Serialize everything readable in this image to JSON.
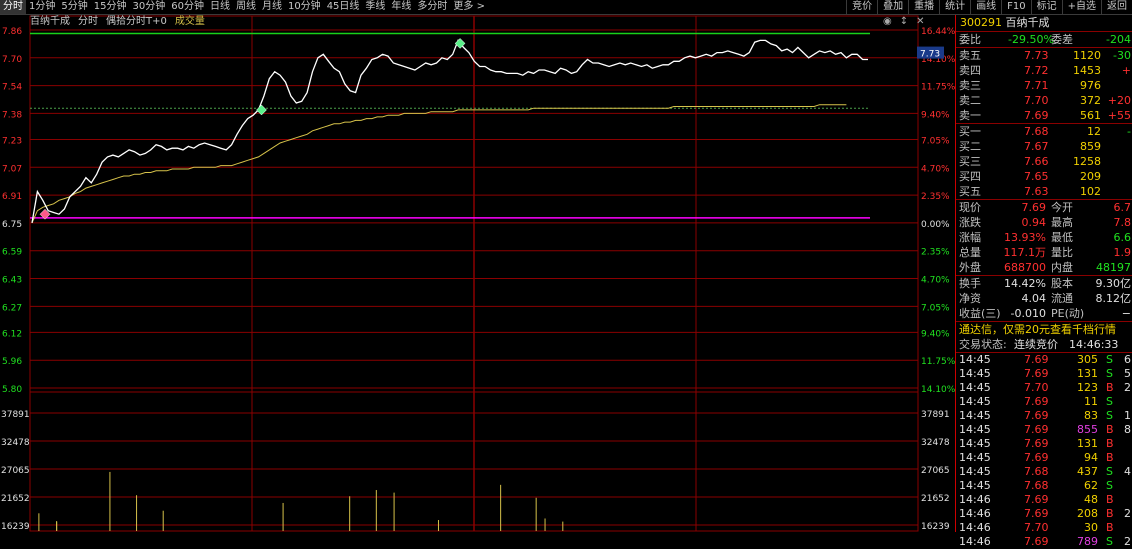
{
  "top_tabs": [
    "分时",
    "1分钟",
    "5分钟",
    "15分钟",
    "30分钟",
    "60分钟",
    "日线",
    "周线",
    "月线",
    "10分钟",
    "45日线",
    "季线",
    "年线",
    "多分时",
    "更多 >"
  ],
  "right_buttons": [
    "竞价",
    "叠加",
    "重播",
    "统计",
    "画线",
    "F10",
    "标记",
    "+自选",
    "返回"
  ],
  "chart_header": {
    "name": "百纳千成",
    "mode": "分时",
    "sub": "偶拾分时T+0",
    "vol": "成交量"
  },
  "chart_ctrls": {
    "a": "◉",
    "b": "↕",
    "c": "✕"
  },
  "colors": {
    "up": "#ff3030",
    "down": "#20e020",
    "price_line": "#ffffff",
    "avg_line": "#d6c24a",
    "limit_line": "#19d019",
    "base_line": "#ff00ff",
    "grid": "#8a0000"
  },
  "price_axis": {
    "left": [
      "7.86",
      "7.70",
      "7.54",
      "7.38",
      "7.23",
      "7.07",
      "6.91",
      "6.75",
      "6.59",
      "6.43",
      "6.27",
      "6.12",
      "5.96",
      "5.80"
    ],
    "right": [
      "16.44%",
      "14.10%",
      "11.75%",
      "9.40%",
      "7.05%",
      "4.70%",
      "2.35%",
      "0.00%",
      "2.35%",
      "4.70%",
      "7.05%",
      "9.40%",
      "11.75%",
      "14.10%"
    ],
    "current_price_tag": "7.73"
  },
  "volume_axis": {
    "left": [
      "37891",
      "32478",
      "27065",
      "21652",
      "16239"
    ],
    "right": [
      "37891",
      "32478",
      "27065",
      "21652",
      "16239"
    ]
  },
  "chart_data": {
    "type": "line",
    "base": 6.75,
    "ylim": [
      5.8,
      7.86
    ],
    "limit_up": 7.84,
    "dashed_level": 7.41,
    "price": [
      6.75,
      6.93,
      6.88,
      6.82,
      6.81,
      6.8,
      6.83,
      6.9,
      6.93,
      6.96,
      7.01,
      6.98,
      7.03,
      7.1,
      7.13,
      7.14,
      7.13,
      7.15,
      7.17,
      7.16,
      7.14,
      7.15,
      7.17,
      7.2,
      7.19,
      7.17,
      7.18,
      7.18,
      7.17,
      7.19,
      7.18,
      7.2,
      7.21,
      7.2,
      7.19,
      7.18,
      7.17,
      7.2,
      7.26,
      7.31,
      7.35,
      7.37,
      7.4,
      7.48,
      7.58,
      7.62,
      7.6,
      7.56,
      7.48,
      7.44,
      7.45,
      7.5,
      7.62,
      7.7,
      7.72,
      7.68,
      7.64,
      7.62,
      7.55,
      7.51,
      7.5,
      7.6,
      7.64,
      7.69,
      7.7,
      7.72,
      7.71,
      7.67,
      7.66,
      7.65,
      7.64,
      7.63,
      7.65,
      7.67,
      7.66,
      7.67,
      7.7,
      7.69,
      7.72,
      7.8,
      7.76,
      7.73,
      7.68,
      7.65,
      7.65,
      7.63,
      7.62,
      7.62,
      7.61,
      7.61,
      7.61,
      7.6,
      7.62,
      7.61,
      7.63,
      7.63,
      7.62,
      7.61,
      7.64,
      7.63,
      7.61,
      7.62,
      7.66,
      7.69,
      7.67,
      7.67,
      7.66,
      7.65,
      7.66,
      7.67,
      7.66,
      7.67,
      7.66,
      7.65,
      7.66,
      7.64,
      7.65,
      7.66,
      7.66,
      7.68,
      7.68,
      7.7,
      7.71,
      7.7,
      7.71,
      7.72,
      7.71,
      7.73,
      7.73,
      7.74,
      7.73,
      7.72,
      7.71,
      7.73,
      7.79,
      7.8,
      7.8,
      7.78,
      7.77,
      7.74,
      7.75,
      7.73,
      7.76,
      7.73,
      7.7,
      7.72,
      7.74,
      7.73,
      7.74,
      7.72,
      7.73,
      7.7,
      7.72,
      7.72,
      7.69,
      7.69
    ],
    "avg": [
      6.75,
      6.82,
      6.84,
      6.85,
      6.86,
      6.88,
      6.89,
      6.9,
      6.92,
      6.93,
      6.95,
      6.96,
      6.97,
      6.98,
      6.99,
      7.0,
      7.01,
      7.02,
      7.02,
      7.03,
      7.03,
      7.04,
      7.04,
      7.05,
      7.05,
      7.05,
      7.06,
      7.06,
      7.06,
      7.06,
      7.07,
      7.07,
      7.07,
      7.07,
      7.07,
      7.08,
      7.08,
      7.08,
      7.09,
      7.1,
      7.11,
      7.12,
      7.13,
      7.15,
      7.17,
      7.19,
      7.21,
      7.22,
      7.23,
      7.24,
      7.25,
      7.26,
      7.28,
      7.29,
      7.3,
      7.31,
      7.32,
      7.32,
      7.33,
      7.33,
      7.34,
      7.34,
      7.35,
      7.35,
      7.36,
      7.36,
      7.37,
      7.37,
      7.37,
      7.38,
      7.38,
      7.38,
      7.38,
      7.38,
      7.39,
      7.39,
      7.39,
      7.39,
      7.39,
      7.4,
      7.4,
      7.4,
      7.4,
      7.4,
      7.4,
      7.4,
      7.4,
      7.4,
      7.4,
      7.4,
      7.4,
      7.4,
      7.4,
      7.41,
      7.41,
      7.41,
      7.41,
      7.41,
      7.41,
      7.41,
      7.41,
      7.41,
      7.41,
      7.41,
      7.41,
      7.41,
      7.41,
      7.41,
      7.41,
      7.41,
      7.41,
      7.41,
      7.41,
      7.41,
      7.41,
      7.41,
      7.41,
      7.41,
      7.41,
      7.42,
      7.42,
      7.42,
      7.42,
      7.42,
      7.42,
      7.42,
      7.42,
      7.42,
      7.42,
      7.42,
      7.42,
      7.42,
      7.42,
      7.42,
      7.42,
      7.42,
      7.42,
      7.42,
      7.42,
      7.42,
      7.42,
      7.42,
      7.42,
      7.42,
      7.42,
      7.42,
      7.43,
      7.43,
      7.43,
      7.43,
      7.43,
      7.43
    ],
    "volume_bars": [
      {
        "t": 0.01,
        "v": 18500,
        "c": "up"
      },
      {
        "t": 0.03,
        "v": 17000,
        "c": "up"
      },
      {
        "t": 0.09,
        "v": 26500,
        "c": "up"
      },
      {
        "t": 0.12,
        "v": 22000,
        "c": "up"
      },
      {
        "t": 0.15,
        "v": 19000,
        "c": "up"
      },
      {
        "t": 0.285,
        "v": 20500,
        "c": "up"
      },
      {
        "t": 0.36,
        "v": 21800,
        "c": "up"
      },
      {
        "t": 0.39,
        "v": 23000,
        "c": "up"
      },
      {
        "t": 0.41,
        "v": 22500,
        "c": "up"
      },
      {
        "t": 0.53,
        "v": 24000,
        "c": "up"
      },
      {
        "t": 0.57,
        "v": 21500,
        "c": "up"
      },
      {
        "t": 0.58,
        "v": 17500,
        "c": "up"
      },
      {
        "t": 0.03,
        "v": 16800,
        "c": "up"
      },
      {
        "t": 0.46,
        "v": 17200,
        "c": "up"
      },
      {
        "t": 0.6,
        "v": 16900,
        "c": "up"
      }
    ],
    "volume_ylim": [
      16239,
      37891
    ]
  },
  "sidebar": {
    "code": "300291",
    "name": "百纳千成",
    "weibi": {
      "label": "委比",
      "value": "-29.50%",
      "label2": "委差",
      "value2": "-204"
    },
    "sells": [
      {
        "label": "卖五",
        "price": "7.73",
        "vol": "1120",
        "chg": "-30"
      },
      {
        "label": "卖四",
        "price": "7.72",
        "vol": "1453",
        "chg": "+"
      },
      {
        "label": "卖三",
        "price": "7.71",
        "vol": "976",
        "chg": ""
      },
      {
        "label": "卖二",
        "price": "7.70",
        "vol": "372",
        "chg": "+20"
      },
      {
        "label": "卖一",
        "price": "7.69",
        "vol": "561",
        "chg": "+55"
      }
    ],
    "buys": [
      {
        "label": "买一",
        "price": "7.68",
        "vol": "12",
        "chg": "-"
      },
      {
        "label": "买二",
        "price": "7.67",
        "vol": "859",
        "chg": ""
      },
      {
        "label": "买三",
        "price": "7.66",
        "vol": "1258",
        "chg": ""
      },
      {
        "label": "买四",
        "price": "7.65",
        "vol": "209",
        "chg": ""
      },
      {
        "label": "买五",
        "price": "7.63",
        "vol": "102",
        "chg": ""
      }
    ],
    "stats": [
      {
        "l1": "现价",
        "v1": "7.69",
        "l2": "今开",
        "v2": "6.7"
      },
      {
        "l1": "涨跌",
        "v1": "0.94",
        "l2": "最高",
        "v2": "7.8"
      },
      {
        "l1": "涨幅",
        "v1": "13.93%",
        "l2": "最低",
        "v2": "6.6"
      },
      {
        "l1": "总量",
        "v1": "117.1万",
        "l2": "量比",
        "v2": "1.9"
      },
      {
        "l1": "外盘",
        "v1": "688700",
        "l2": "内盘",
        "v2": "48197"
      }
    ],
    "stats2": [
      {
        "l1": "换手",
        "v1": "14.42%",
        "l2": "股本",
        "v2": "9.30亿"
      },
      {
        "l1": "净资",
        "v1": "4.04",
        "l2": "流通",
        "v2": "8.12亿"
      },
      {
        "l1": "收益(三)",
        "v1": "-0.010",
        "l2": "PE(动)",
        "v2": "−"
      }
    ],
    "notice": "通达信，仅需20元查看千档行情",
    "trade_status": {
      "label": "交易状态:",
      "value": "连续竞价",
      "time": "14:46:33"
    },
    "ticks": [
      {
        "time": "14:45",
        "price": "7.69",
        "vol": "305",
        "bs": "S",
        "n": "6"
      },
      {
        "time": "14:45",
        "price": "7.69",
        "vol": "131",
        "bs": "S",
        "n": "5"
      },
      {
        "time": "14:45",
        "price": "7.70",
        "vol": "123",
        "bs": "B",
        "n": "2"
      },
      {
        "time": "14:45",
        "price": "7.69",
        "vol": "11",
        "bs": "S",
        "n": ""
      },
      {
        "time": "14:45",
        "price": "7.69",
        "vol": "83",
        "bs": "S",
        "n": "1"
      },
      {
        "time": "14:45",
        "price": "7.69",
        "vol": "855",
        "bs": "B",
        "n": "8"
      },
      {
        "time": "14:45",
        "price": "7.69",
        "vol": "131",
        "bs": "B",
        "n": ""
      },
      {
        "time": "14:45",
        "price": "7.69",
        "vol": "94",
        "bs": "B",
        "n": ""
      },
      {
        "time": "14:45",
        "price": "7.68",
        "vol": "437",
        "bs": "S",
        "n": "4"
      },
      {
        "time": "14:45",
        "price": "7.68",
        "vol": "62",
        "bs": "S",
        "n": ""
      },
      {
        "time": "14:46",
        "price": "7.69",
        "vol": "48",
        "bs": "B",
        "n": ""
      },
      {
        "time": "14:46",
        "price": "7.69",
        "vol": "208",
        "bs": "B",
        "n": "2"
      },
      {
        "time": "14:46",
        "price": "7.70",
        "vol": "30",
        "bs": "B",
        "n": ""
      },
      {
        "time": "14:46",
        "price": "7.69",
        "vol": "789",
        "bs": "S",
        "n": "2"
      }
    ]
  }
}
